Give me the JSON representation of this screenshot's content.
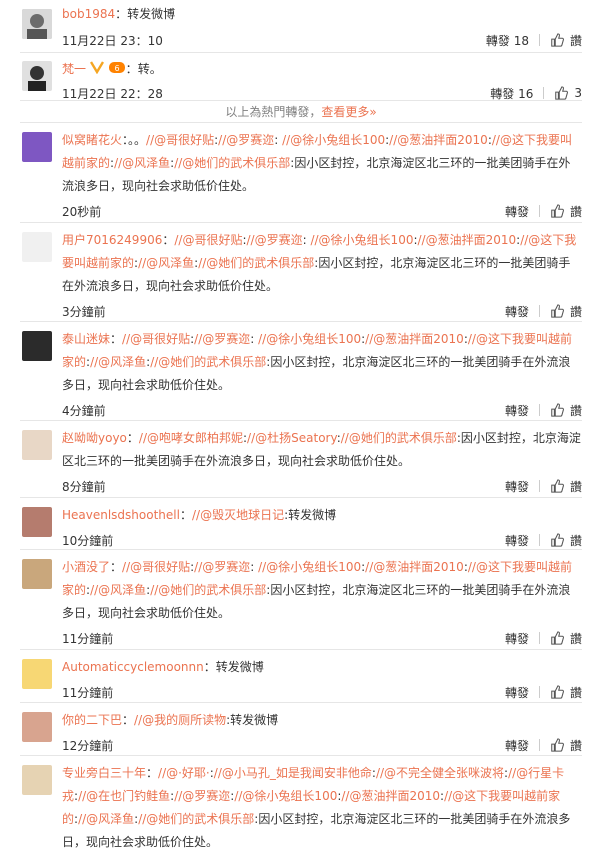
{
  "hot": [
    {
      "user": "bob1984",
      "sep": "：",
      "text": "转发微博",
      "time": "11月22日 23：10",
      "repost": "轉發 18",
      "like": "",
      "reply": "讚"
    },
    {
      "user": "梵一",
      "sep": "：",
      "text": "转。",
      "time": "11月22日 22：28",
      "repost": "轉發 16",
      "like": "3",
      "reply": ""
    }
  ],
  "divider": {
    "text": "以上為熱門轉發，",
    "more": "查看更多»"
  },
  "items": [
    {
      "user": "似窝睹花火",
      "parts": [
        "：。。",
        "//@哥很好贴",
        ":",
        "//@罗赛迩",
        ": ",
        "//@徐小兔组长100",
        ":",
        "//@葱油拌面2010",
        ":",
        "//@这下我要叫越前家的",
        ":",
        "//@风泽鱼",
        ":",
        "//@她们的武术俱乐部",
        ":因小区封控，北京海淀区北三环的一批美团骑手在外流浪多日，现向社会求助低价住处。"
      ],
      "time": "20秒前",
      "repost": "轉發",
      "reply": "讚"
    },
    {
      "user": "用户7016249906",
      "parts": [
        "：",
        "//@哥很好贴",
        ":",
        "//@罗赛迩",
        ": ",
        "//@徐小兔组长100",
        ":",
        "//@葱油拌面2010",
        ":",
        "//@这下我要叫越前家的",
        ":",
        "//@风泽鱼",
        ":",
        "//@她们的武术俱乐部",
        ":因小区封控，北京海淀区北三环的一批美团骑手在外流浪多日，现向社会求助低价住处。"
      ],
      "time": "3分鐘前",
      "repost": "轉發",
      "reply": "讚"
    },
    {
      "user": "泰山迷妹",
      "parts": [
        "：",
        "//@哥很好贴",
        ":",
        "//@罗赛迩",
        ": ",
        "//@徐小兔组长100",
        ":",
        "//@葱油拌面2010",
        ":",
        "//@这下我要叫越前家的",
        ":",
        "//@风泽鱼",
        ":",
        "//@她们的武术俱乐部",
        ":因小区封控，北京海淀区北三环的一批美团骑手在外流浪多日，现向社会求助低价住处。"
      ],
      "time": "4分鐘前",
      "repost": "轉發",
      "reply": "讚"
    },
    {
      "user": "赵呦呦yoyo",
      "parts": [
        "：",
        "//@咆哮女郎柏邦妮",
        ":",
        "//@杜扬Seatory",
        ":",
        "//@她们的武术俱乐部",
        ":因小区封控，北京海淀区北三环的一批美团骑手在外流浪多日，现向社会求助低价住处。"
      ],
      "time": "8分鐘前",
      "repost": "轉發",
      "reply": "讚"
    },
    {
      "user": "Heavenlsdshoothell",
      "parts": [
        "：",
        "//@毁灭地球日记",
        ":转发微博"
      ],
      "time": "10分鐘前",
      "repost": "轉發",
      "reply": "讚"
    },
    {
      "user": "小酒没了",
      "parts": [
        "：",
        "//@哥很好贴",
        ":",
        "//@罗赛迩",
        ": ",
        "//@徐小兔组长100",
        ":",
        "//@葱油拌面2010",
        ":",
        "//@这下我要叫越前家的",
        ":",
        "//@风泽鱼",
        ":",
        "//@她们的武术俱乐部",
        ":因小区封控，北京海淀区北三环的一批美团骑手在外流浪多日，现向社会求助低价住处。"
      ],
      "time": "11分鐘前",
      "repost": "轉發",
      "reply": "讚"
    },
    {
      "user": "Automaticcyclemoonnn",
      "parts": [
        "：转发微博"
      ],
      "time": "11分鐘前",
      "repost": "轉發",
      "reply": "讚"
    },
    {
      "user": "你的二下巴",
      "parts": [
        "：",
        "//@我的厕所读物",
        ":转发微博"
      ],
      "time": "12分鐘前",
      "repost": "轉發",
      "reply": "讚"
    },
    {
      "user": "专业旁白三十年",
      "parts": [
        "：",
        "//@·好耶·",
        ":",
        "//@小马孔_如是我闻安非他命",
        ":",
        "//@不完全健全张咪波将",
        ":",
        "//@行星卡戎",
        ":",
        "//@在也门钓鲑鱼",
        ":",
        "//@罗赛迩",
        ":",
        "//@徐小兔组长100",
        ":",
        "//@葱油拌面2010",
        ":",
        "//@这下我要叫越前家的",
        ":",
        "//@风泽鱼",
        ":",
        "//@她们的武术俱乐部",
        ":因小区封控，北京海淀区北三环的一批美团骑手在外流浪多日，现向社会求助低价住处。"
      ],
      "time": "",
      "repost": "",
      "reply": ""
    }
  ],
  "colors": {
    "accent": "#eb7350",
    "text": "#333333",
    "border": "#e6e6e6"
  }
}
